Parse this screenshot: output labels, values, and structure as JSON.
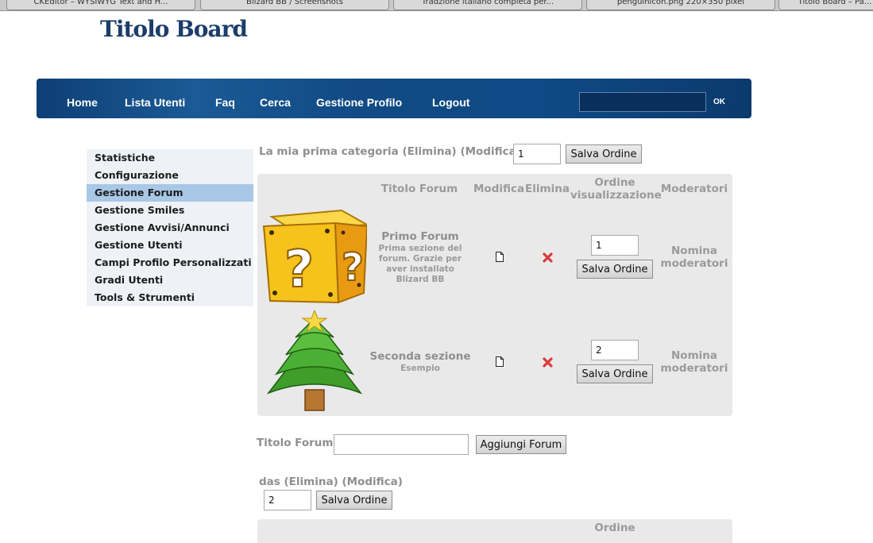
{
  "browser": {
    "tabs": [
      "CKEditor – WYSIWYG Text and H...",
      "Blizard BB / Screenshots",
      "Tradzione italiano completa per...",
      "penguinicon.png 220×350 pixel",
      "Titolo Board – Pa..."
    ]
  },
  "board": {
    "title": "Titolo Board"
  },
  "nav": {
    "items": [
      "Home",
      "Lista Utenti",
      "Faq",
      "Cerca",
      "Gestione Profilo",
      "Logout"
    ],
    "search_value": "",
    "ok_label": "OK"
  },
  "sidebar": {
    "items": [
      "Statistiche",
      "Configurazione",
      "Gestione Forum",
      "Gestione Smiles",
      "Gestione Avvisi/Annunci",
      "Gestione Utenti",
      "Campi Profilo Personalizzati",
      "Gradi Utenti",
      "Tools & Strumenti"
    ],
    "active_index": 2
  },
  "category1": {
    "name": "La mia prima categoria",
    "delete_label": "(Elimina)",
    "edit_label": "(Modifica)",
    "order_value": "1",
    "save_order_label": "Salva Ordine"
  },
  "table": {
    "headers": {
      "title": "Titolo Forum",
      "edit": "Modifica",
      "delete": "Elimina",
      "order_line1": "Ordine",
      "order_line2": "visualizzazione",
      "moderators": "Moderatori"
    },
    "forums": [
      {
        "icon": "question-block-icon",
        "title": "Primo Forum",
        "desc_lines": [
          "Prima sezione del",
          "forum. Grazie per",
          "aver installato",
          "Blizard BB"
        ],
        "order_value": "1",
        "save_order_label": "Salva Ordine",
        "moderators_line1": "Nomina",
        "moderators_line2": "moderatori"
      },
      {
        "icon": "christmas-tree-icon",
        "title": "Seconda sezione",
        "desc_lines": [
          "Esempio"
        ],
        "order_value": "2",
        "save_order_label": "Salva Ordine",
        "moderators_line1": "Nomina",
        "moderators_line2": "moderatori"
      }
    ]
  },
  "add_forum": {
    "label": "Titolo Forum",
    "value": "",
    "button_label": "Aggiungi Forum"
  },
  "category2": {
    "name": "das",
    "delete_label": "(Elimina)",
    "edit_label": "(Modifica)",
    "order_value": "2",
    "save_order_label": "Salva Ordine",
    "order_head": "Ordine"
  },
  "colors": {
    "nav_dark": "#0e3f76",
    "board_title": "#1b3d6a",
    "sidebar_active": "#a9c7e6",
    "panel_bg": "#e9e9e9",
    "delete_red": "#d93b3b"
  }
}
